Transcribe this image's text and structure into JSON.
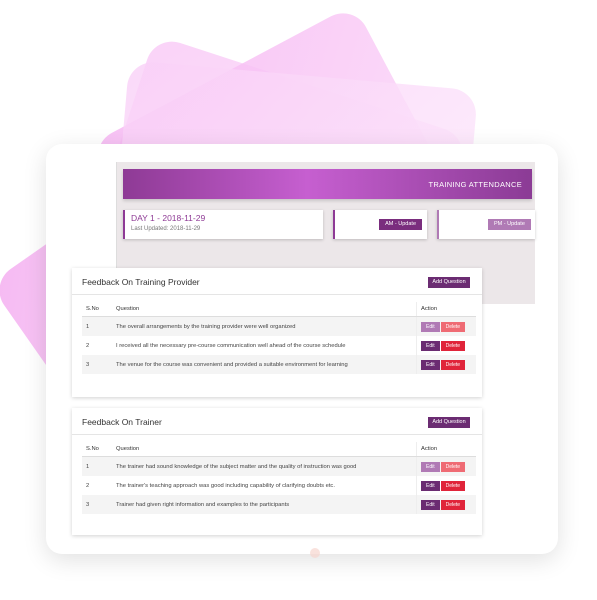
{
  "attendance": {
    "title": "TRAINING ATTENDANCE",
    "day_title": "DAY 1 - 2018-11-29",
    "last_updated": "Last Updated: 2018-11-29",
    "am_button": "AM - Update",
    "pm_button": "PM - Update"
  },
  "feedback_provider": {
    "title": "Feedback On Training Provider",
    "add_button": "Add Question",
    "columns": [
      "S.No",
      "Question",
      "Action"
    ],
    "rows": [
      {
        "sno": "1",
        "question": "The overall arrangements by the training provider were well organized",
        "edit": "Edit",
        "delete": "Delete"
      },
      {
        "sno": "2",
        "question": "I received all the necessary pre-course communication well ahead of the course schedule",
        "edit": "Edit",
        "delete": "Delete"
      },
      {
        "sno": "3",
        "question": "The venue for the course was convenient and provided a suitable environment for learning",
        "edit": "Edit",
        "delete": "Delete"
      }
    ]
  },
  "feedback_trainer": {
    "title": "Feedback On Trainer",
    "add_button": "Add Question",
    "columns": [
      "S.No",
      "Question",
      "Action"
    ],
    "rows": [
      {
        "sno": "1",
        "question": "The trainer had sound knowledge of the subject matter and the quality of instruction was good",
        "edit": "Edit",
        "delete": "Delete"
      },
      {
        "sno": "2",
        "question": "The trainer's teaching approach was good including capability of clarifying doubts etc.",
        "edit": "Edit",
        "delete": "Delete"
      },
      {
        "sno": "3",
        "question": "Trainer had given right information and examples to the participants",
        "edit": "Edit",
        "delete": "Delete"
      }
    ]
  },
  "colors": {
    "accent": "#8e3a95",
    "accent_dark": "#6b2c72",
    "accent_light": "#b07ab5",
    "danger": "#e0243a",
    "decor_pink": "#f6b7f3"
  }
}
